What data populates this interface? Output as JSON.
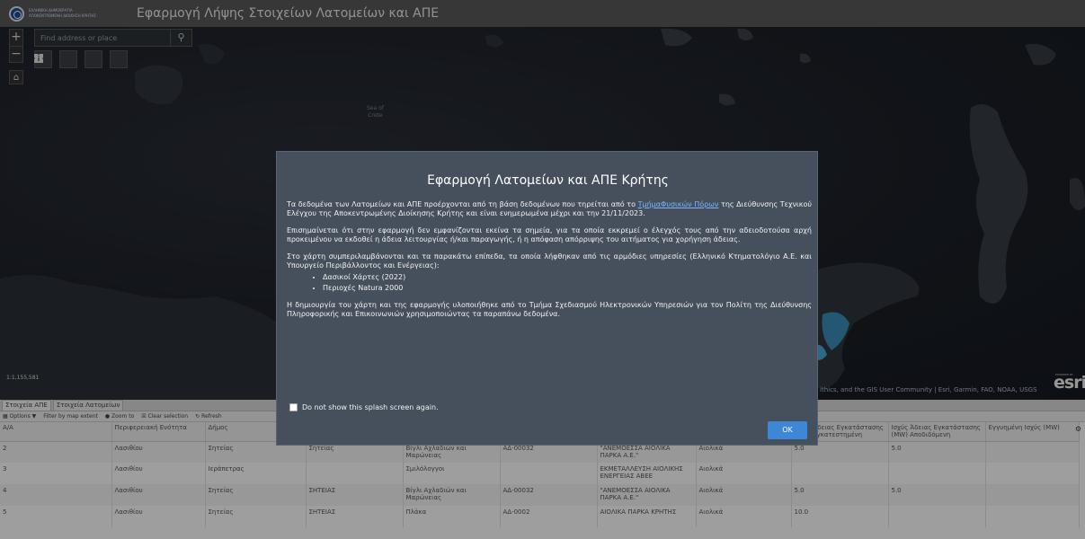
{
  "header": {
    "logo_text_line1": "ΕΛΛΗΝΙΚΗ ΔΗΜΟΚΡΑΤΙΑ",
    "logo_text_line2": "ΑΠΟΚΕΝΤΡΩΜΕΝΗ ΔΙΟΙΚΗΣΗ ΚΡΗΤΗΣ",
    "title": "Εφαρμογή Λήψης Στοιχείων Λατομείων και ΑΠΕ"
  },
  "map": {
    "search_placeholder": "Find address or place",
    "sea_label_line1": "Sea of",
    "sea_label_line2": "Crete",
    "scale": "1:1,155,581",
    "attribution": "ithics, and the GIS User Community | Esri, Garmin, FAO, NOAA, USGS",
    "esri_small": "POWERED BY",
    "esri_logo": "esri",
    "zoom_in": "+",
    "zoom_out": "−"
  },
  "panel": {
    "tabs": [
      {
        "label": "Στοιχεία ΑΠΕ"
      },
      {
        "label": "Στοιχεία Λατομείων"
      }
    ],
    "toolbar": {
      "options": "Options ▼",
      "filter": "Filter by map extent",
      "zoom": "Zoom to",
      "clear": "Clear selection",
      "refresh": "Refresh"
    },
    "columns": [
      "Α/Α",
      "Περιφερειακή Ενότητα",
      "Δήμος",
      "",
      "",
      "",
      "",
      "",
      "Ισχύς Άδειας Εγκατάστασης (MW) Εγκατεστημένη",
      "Ισχύς Άδειας Εγκατάστασης (MW) Αποδιδόμενη",
      "Εγγυημένη Ισχύς (MW)"
    ],
    "rows": [
      [
        "2",
        "Λασιθίου",
        "Σητείας",
        "Σητείας",
        "Βίγλι Αχλαδιών και Μαρώνειας",
        "ΑΔ-00032",
        "\"ΑΝΕΜΟΕΣΣΑ ΑΙΟΛΙΚΑ ΠΑΡΚΑ Α.Ε.\"",
        "Αιολικά",
        "5.0",
        "5.0",
        ""
      ],
      [
        "3",
        "Λασιθίου",
        "Ιεράπετρας",
        "",
        "Σμιλόλογγοι",
        "",
        "ΕΚΜΕΤΑΛΛΕΥΣΗ ΑΙΟΛΙΚΗΣ ΕΝΕΡΓΕΙΑΣ ΑΒΕΕ",
        "Αιολικά",
        "",
        "",
        ""
      ],
      [
        "4",
        "Λασιθίου",
        "Σητείας",
        "ΣΗΤΕΙΑΣ",
        "Βίγλι Αχλαδιών και Μαρώνειας",
        "ΑΔ-00032",
        "\"ΑΝΕΜΟΕΣΣΑ ΑΙΟΛΙΚΑ ΠΑΡΚΑ Α.Ε.\"",
        "Αιολικά",
        "5.0",
        "5.0",
        ""
      ],
      [
        "5",
        "Λασιθίου",
        "Σητείας",
        "ΣΗΤΕΙΑΣ",
        "Πλάκα",
        "ΑΔ-0002",
        "ΑΙΟΛΙΚΑ ΠΑΡΚΑ ΚΡΗΤΗΣ",
        "Αιολικά",
        "10.0",
        "",
        ""
      ]
    ]
  },
  "modal": {
    "title": "Εφαρμογή Λατομείων και ΑΠΕ Κρήτης",
    "p1_before": "Τα δεδομένα των Λατομείων και ΑΠΕ προέρχονται από τη βάση δεδομένων που τηρείται από το ",
    "p1_link": "ΤμήμαΦυσικών Πόρων",
    "p1_after": " της Διεύθυνσης Τεχνικού Ελέγχου της Αποκεντρωμένης Διοίκησης Κρήτης και είναι ενημερωμένα μέχρι και την 21/11/2023.",
    "p2": "Επισημαίνεται ότι στην εφαρμογή δεν εμφανίζονται εκείνα τα σημεία, για τα οποία εκκρεμεί ο έλεγχός τους από την αδειοδοτούσα αρχή προκειμένου να εκδοθεί η άδεια λειτουργίας ή/και παραγωγής, ή η απόφαση απόρριψης του αιτήματος για χορήγηση άδειας.",
    "p3": "Στο χάρτη συμπεριλαμβάνονται και τα παρακάτω επίπεδα, τα οποία λήφθηκαν από τις αρμόδιες υπηρεσίες (Ελληνικό Κτηματολόγιο Α.Ε. και Υπουργείο Περιβάλλοντος και Ενέργειας):",
    "list": [
      "Δασικοί Χάρτες (2022)",
      "Περιοχές Natura 2000"
    ],
    "p4": "Η δημιουργία του χάρτη και της εφαρμογής υλοποιήθηκε από το Τμήμα Σχεδιασμού Ηλεκτρονικών Υπηρεσιών για τον Πολίτη της Διεύθυνσης Πληροφορικής και Επικοινωνιών χρησιμοποιώντας τα παραπάνω δεδομένα.",
    "checkbox_label": "Do not show this splash screen again.",
    "ok_label": "OK"
  }
}
